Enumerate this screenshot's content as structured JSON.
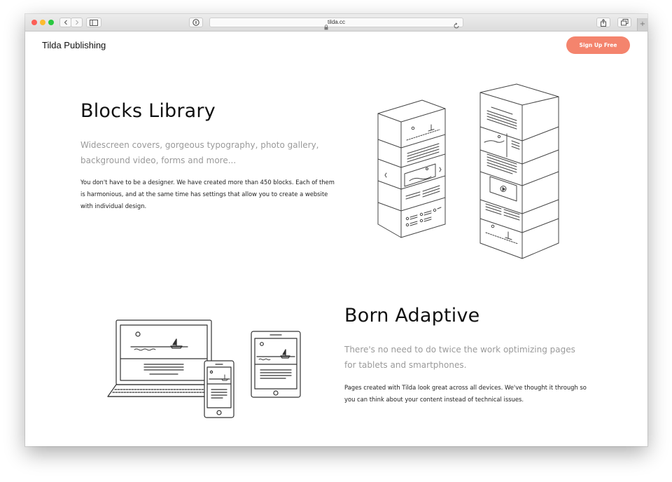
{
  "browser": {
    "url": "tilda.cc",
    "new_tab_symbol": "+"
  },
  "header": {
    "brand": "Tilda Publishing",
    "signup_label": "Sign Up Free"
  },
  "sections": [
    {
      "title": "Blocks Library",
      "lead": "Widescreen covers, gorgeous typography, photo gallery, background video, forms and more...",
      "body": "You don't have to be a designer. We have created more than 450 blocks. Each of them is harmonious, and at the same time has settings that allow you to create a website with individual design."
    },
    {
      "title": "Born Adaptive",
      "lead": "There's no need to do twice the work optimizing pages for tablets and smartphones.",
      "body": "Pages created with Tilda look great across all devices. We've thought it through so you can think about your content instead of technical issues."
    }
  ],
  "colors": {
    "accent": "#f4846d",
    "title_text": "#111111",
    "lead_text": "#9a9a9a",
    "body_text": "#222222"
  }
}
